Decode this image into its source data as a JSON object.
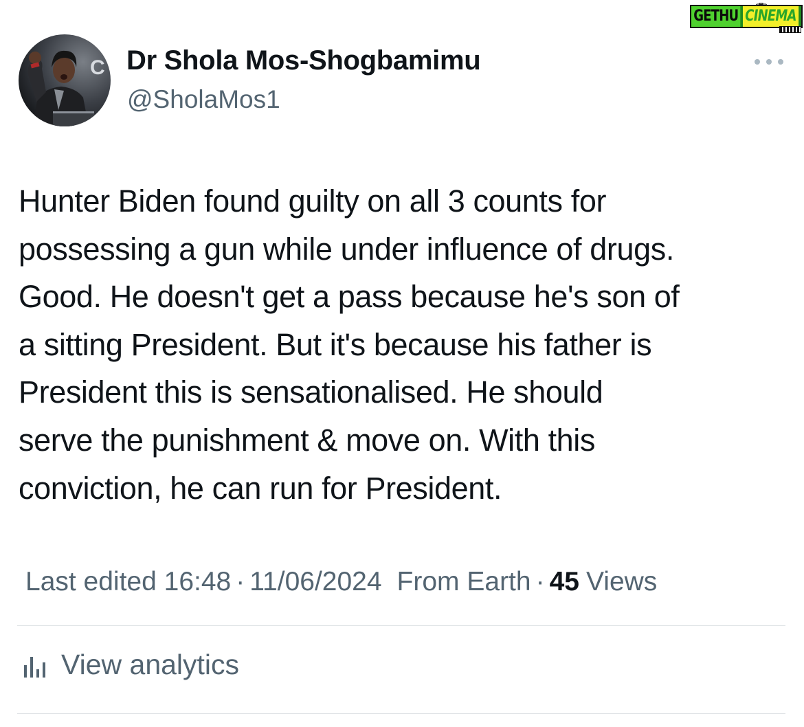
{
  "watermark": {
    "part1": "GETHU",
    "part2": "CINEMA"
  },
  "author": {
    "display_name": "Dr Shola Mos-Shogbamimu",
    "handle": "@SholaMos1",
    "avatar_icon": "profile-photo"
  },
  "tweet": {
    "lines": [
      "Hunter Biden found guilty on all 3 counts for",
      "possessing a gun while under influence of drugs.",
      "Good. He doesn't get a pass because he's son of",
      "a sitting President. But it's because his father is",
      "President this is sensationalised. He should",
      "serve the punishment & move on. With this",
      "conviction, he can run for President."
    ]
  },
  "meta": {
    "edited_label": "Last edited 16:48",
    "separator": "·",
    "date": "11/06/2024",
    "source": "From Earth",
    "views_count": "45",
    "views_label": "Views"
  },
  "analytics": {
    "label": "View analytics",
    "icon": "bar-chart-icon"
  },
  "colors": {
    "primary_text": "#0f1419",
    "secondary_text": "#536471",
    "divider": "#dfe3e6"
  }
}
